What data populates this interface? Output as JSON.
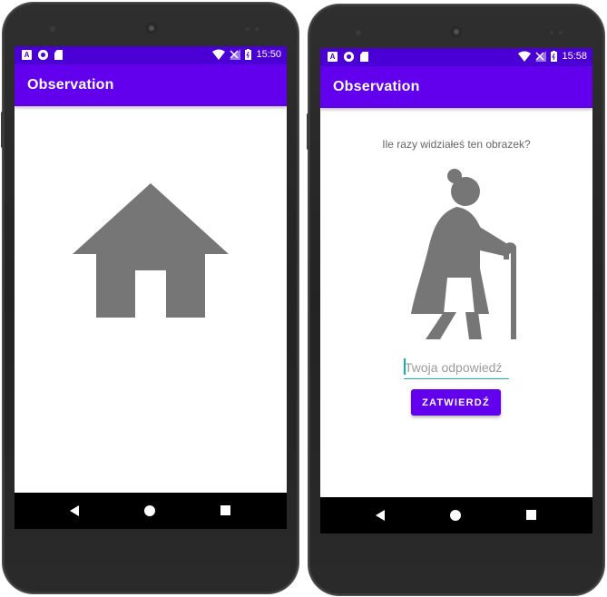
{
  "screens": [
    {
      "status": {
        "time": "15:50",
        "left_icons": [
          "a-square-icon",
          "record-icon",
          "sd-card-icon"
        ],
        "right_icons": [
          "wifi-icon",
          "signal-icon",
          "battery-icon"
        ]
      },
      "app_title": "Observation",
      "content_icon": "house-icon"
    },
    {
      "status": {
        "time": "15:58",
        "left_icons": [
          "a-square-icon",
          "record-icon",
          "sd-card-icon"
        ],
        "right_icons": [
          "wifi-icon",
          "signal-icon",
          "battery-icon"
        ]
      },
      "app_title": "Observation",
      "question": "Ile razy widziałeś ten obrazek?",
      "content_icon": "elderly-person-icon",
      "answer_placeholder": "Twoja odpowiedź",
      "submit_label": "ZATWIERDŹ"
    }
  ],
  "navbar": {
    "icons": [
      "back-icon",
      "home-icon",
      "recents-icon"
    ]
  },
  "colors": {
    "primary": "#6200ee",
    "primary_dark": "#4a00d4",
    "accent": "#12b3a8",
    "icon_gray": "#767676"
  }
}
